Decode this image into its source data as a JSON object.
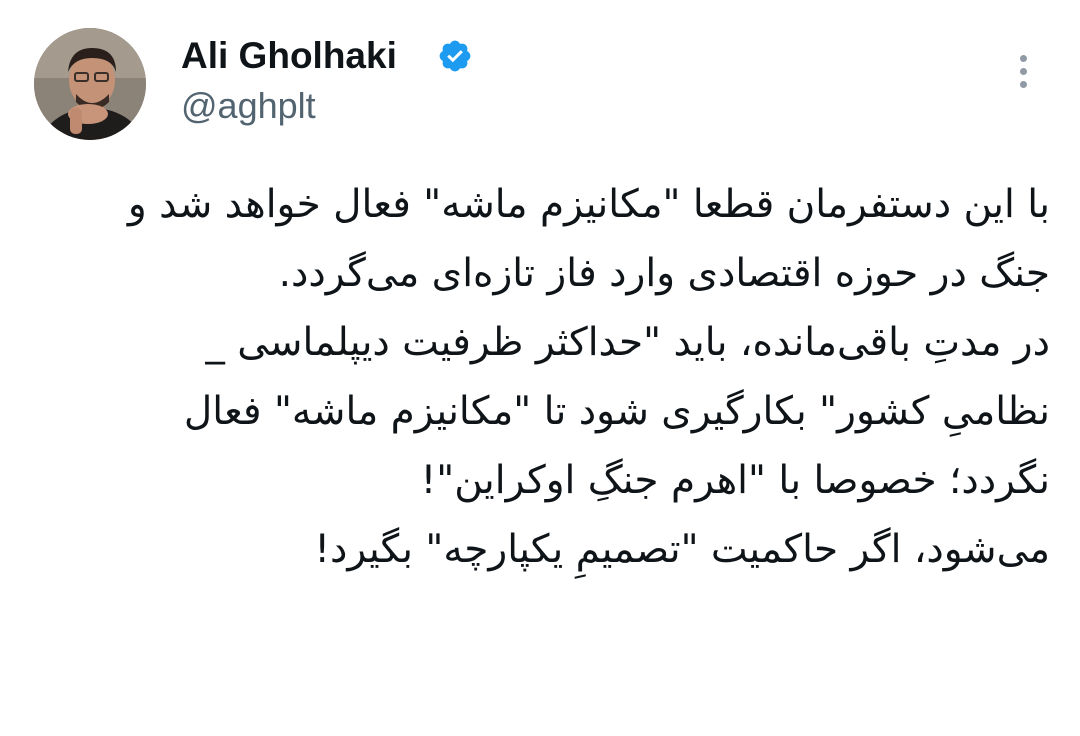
{
  "author": {
    "name": "Ali Gholhaki",
    "handle": "@aghplt",
    "verified": true,
    "verified_color": "#1d9bf0"
  },
  "tweet": {
    "lines": [
      "با این دستفرمان قطعا \"مکانیزم ماشه\" فعال خواهد شد و",
      "جنگ در حوزه اقتصادی وارد فاز تازه‌ای می‌گردد.",
      "در مدتِ باقی‌مانده، باید \"حداکثر ظرفیت دیپلماسی _",
      "نظامیِ کشور\" بکارگیری شود تا \"مکانیزم ماشه\" فعال",
      "نگردد؛ خصوصا با \"اهرم جنگِ اوکراین\"!",
      "می‌شود، اگر حاکمیت \"تصمیمِ یکپارچه\" بگیرد!"
    ]
  },
  "icons": {
    "verified": "verified-badge-icon",
    "more": "more-vertical-icon",
    "avatar": "avatar"
  },
  "colors": {
    "text": "#0f1419",
    "secondary": "#536471",
    "more_dots": "#8f9aa4"
  }
}
